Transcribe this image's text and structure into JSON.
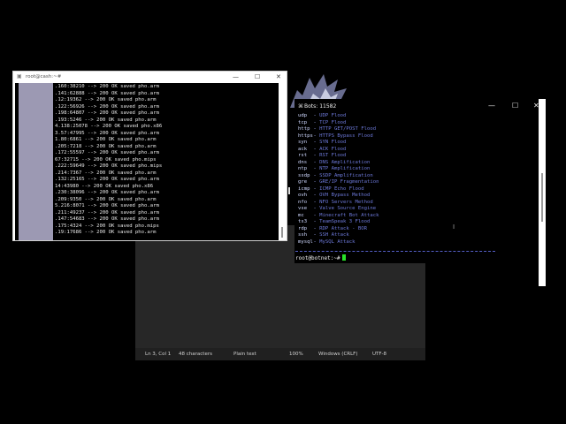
{
  "notepad": {
    "status": {
      "position": "Ln 3, Col 1",
      "characters": "48 characters",
      "format": "Plain text",
      "zoom": "100%",
      "line_endings": "Windows (CRLF)",
      "encoding": "UTF-8"
    }
  },
  "bots_terminal": {
    "title": "Bots: 11582",
    "commands": [
      {
        "name": "udp",
        "desc": "UDP Flood"
      },
      {
        "name": "tcp",
        "desc": "TCP Flood"
      },
      {
        "name": "http",
        "desc": "HTTP GET/POST Flood"
      },
      {
        "name": "https",
        "desc": "HTTPS Bypass Flood"
      },
      {
        "name": "syn",
        "desc": "SYN Flood"
      },
      {
        "name": "ack",
        "desc": "ACK Flood"
      },
      {
        "name": "rst",
        "desc": "RST Flood"
      },
      {
        "name": "dns",
        "desc": "DNS Amplification"
      },
      {
        "name": "ntp",
        "desc": "NTP Amplification"
      },
      {
        "name": "ssdp",
        "desc": "SSDP Amplification"
      },
      {
        "name": "gre",
        "desc": "GRE/IP Fragmentation"
      },
      {
        "name": "icmp",
        "desc": "ICMP Echo Flood"
      },
      {
        "name": "ovh",
        "desc": "OVH Bypass Method"
      },
      {
        "name": "nfo",
        "desc": "NFO Servers Method"
      },
      {
        "name": "vse",
        "desc": "Valve Source Engine"
      },
      {
        "name": "mc",
        "desc": "Minecraft Bot Attack"
      },
      {
        "name": "ts3",
        "desc": "TeamSpeak 3 Flood"
      },
      {
        "name": "rdp",
        "desc": "RDP Attack - BOR"
      },
      {
        "name": "ssh",
        "desc": "SSH Attack"
      },
      {
        "name": "mysql",
        "desc": "MySQL Attack"
      }
    ],
    "dash": " - ",
    "prompt": "root@botnet:~#",
    "colors": {
      "name": "#cfd8ff",
      "desc": "#6c78d8",
      "cursor": "#29e329"
    }
  },
  "cash_terminal": {
    "title": "root@cash:~#",
    "lines": [
      ".160:38210 --> 200 OK saved pho.arm",
      ".141:62888 --> 200 OK saved pho.arm",
      ".12:19362 --> 200 OK saved pho.arm",
      ".122:56926 --> 200 OK saved pho.arm",
      ".198:64807 --> 200 OK saved pho.arm",
      ".193:5246 --> 200 OK saved pho.arm",
      "4.138:25078 --> 200 OK saved pho.x86",
      "3.57:47995 --> 200 OK saved pho.arm",
      "1.80:6861 --> 200 OK saved pho.arm",
      ".205:7218 --> 200 OK saved pho.arm",
      ".172:55597 --> 200 OK saved pho.arm",
      "67:32715 --> 200 OK saved pho.mips",
      ".222:59649 --> 200 OK saved pho.mips",
      ".214:7367 --> 200 OK saved pho.arm",
      ".132:25165 --> 200 OK saved pho.arm",
      "14:43980 --> 200 OK saved pho.x86",
      ".230:38096 --> 200 OK saved pho.arm",
      ".209:9350 --> 200 OK saved pho.arm",
      "5.216:8071 --> 200 OK saved pho.arm",
      ".211:49237 --> 200 OK saved pho.arm",
      ".147:54683 --> 200 OK saved pho.arm",
      ".175:4324 --> 200 OK saved pho.mips",
      ".19:17686 --> 200 OK saved pho.arm"
    ]
  },
  "window_controls": {
    "minimize": "—",
    "maximize": "☐",
    "close": "✕"
  }
}
